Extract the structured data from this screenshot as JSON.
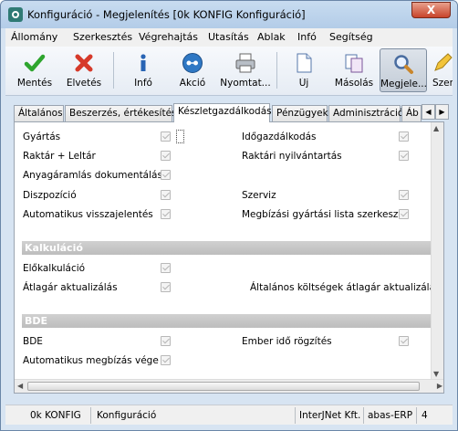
{
  "window": {
    "title": "Konfiguráció - Megjelenítés  [0k  KONFIG  Konfiguráció]",
    "close_glyph": "X"
  },
  "menu": [
    {
      "label": "Állomány"
    },
    {
      "label": "Szerkesztés"
    },
    {
      "label": "Végrehajtás"
    },
    {
      "label": "Utasítás"
    },
    {
      "label": "Ablak"
    },
    {
      "label": "Infó"
    },
    {
      "label": "Segítség"
    }
  ],
  "toolbar": [
    {
      "label": "Mentés",
      "icon": "check-icon",
      "color": "#2ea52e"
    },
    {
      "label": "Elvetés",
      "icon": "x-icon",
      "color": "#d63a2a"
    },
    {
      "label": "Infó",
      "icon": "info-icon",
      "color": "#2864b4"
    },
    {
      "label": "Akció",
      "icon": "action-icon",
      "color": "#2f78c4"
    },
    {
      "label": "Nyomtat...",
      "icon": "printer-icon"
    },
    {
      "label": "Új",
      "icon": "new-document-icon"
    },
    {
      "label": "Másolás",
      "icon": "copy-icon"
    },
    {
      "label": "Megjele...",
      "icon": "magnifier-icon",
      "active": true
    },
    {
      "label": "Szer",
      "icon": "pencil-icon"
    }
  ],
  "tabs": [
    {
      "label": "Általános"
    },
    {
      "label": "Beszerzés, értékesítés"
    },
    {
      "label": "Készletgazdálkodás",
      "active": true
    },
    {
      "label": "Pénzügyek"
    },
    {
      "label": "Adminisztráció"
    },
    {
      "label": "Áb"
    }
  ],
  "tab_scroll": {
    "left": "◀",
    "right": "▶"
  },
  "form": {
    "gyartas": "Gyártás",
    "idogazdalkodas": "Időgazdálkodás",
    "raktar_leltar": "Raktár + Leltár",
    "raktari_nyilvantartas": "Raktári nyilvántartás",
    "anyagaramlas": "Anyagáramlás dokumentálása",
    "diszpozicio": "Diszpozíció",
    "szerviz": "Szerviz",
    "automatikus_visszajelentes": "Automatikus visszajelentés",
    "megbizasi_gyartasi_lista": "Megbízási gyártási lista szerkesztő",
    "kalkulacio_header": "Kalkuláció",
    "elokalkulacio": "Előkalkuláció",
    "atlagar_aktualizalas": "Átlagár aktualizálás",
    "altalanos_koltsegek": "Általános költségek átlagár aktualizálásba",
    "bde_header": "BDE",
    "bde": "BDE",
    "ember_ido_rogzites": "Ember idő rögzítés",
    "automatikus_megbizas_vege": "Automatikus megbízás vége"
  },
  "statusbar": {
    "code": "0k KONFIG",
    "name": "Konfiguráció",
    "company": "InterJNet Kft.",
    "product": "abas-ERP",
    "number": "4"
  }
}
